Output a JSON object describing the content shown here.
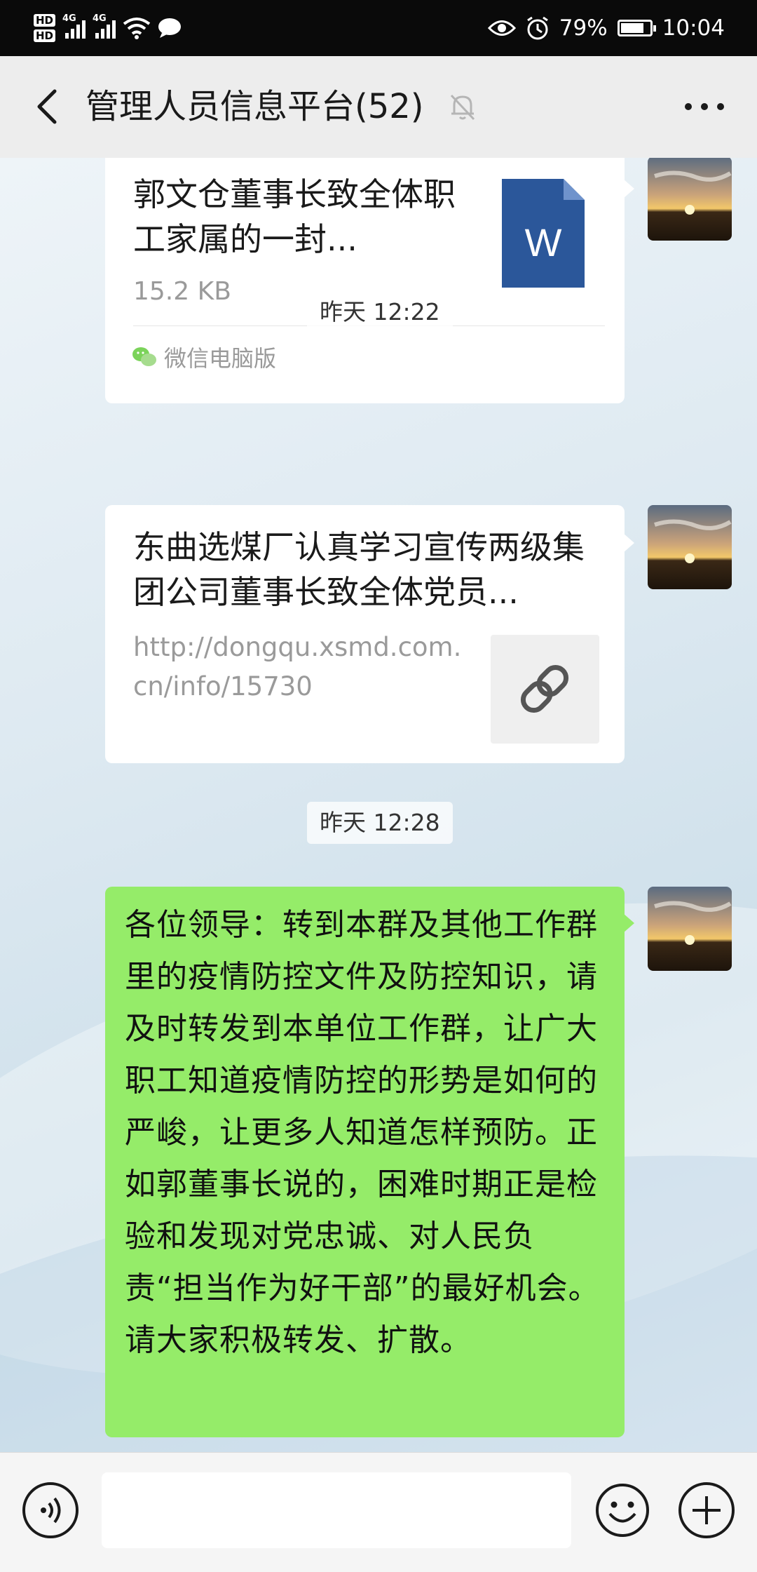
{
  "status_bar": {
    "hd1": "HD",
    "hd2": "HD",
    "net1": "4G",
    "net2": "4G",
    "battery_percent": "79%",
    "battery_level": 0.79,
    "time": "10:04",
    "icons": [
      "signal-icon",
      "wifi-icon",
      "message-icon",
      "eye-icon",
      "alarm-icon",
      "battery-icon"
    ]
  },
  "header": {
    "title": "管理人员信息平台(52)",
    "back_icon": "chevron-left-icon",
    "mute_icon": "bell-off-icon",
    "more_icon": "more-dots-icon"
  },
  "messages": {
    "file_card": {
      "title": "郭文仓董事长致全体职工家属的一封...",
      "size": "15.2 KB",
      "source": "微信电脑版",
      "file_icon_letter": "W"
    },
    "timestamp_1": "昨天 12:22",
    "link_card": {
      "title": "东曲选煤厂认真学习宣传两级集团公司董事长致全体党员...",
      "url": "http://dongqu.xsmd.com.cn/info/15730"
    },
    "timestamp_2": "昨天 12:28",
    "text_bubble": "各位领导：转到本群及其他工作群里的疫情防控文件及防控知识，请及时转发到本单位工作群，让广大职工知道疫情防控的形势是如何的严峻，让更多人知道怎样预防。正如郭董事长说的，困难时期正是检验和发现对党忠诚、对人民负责“担当作为好干部”的最好机会。请大家积极转发、扩散。"
  },
  "input_bar": {
    "placeholder": "",
    "icons": [
      "voice-icon",
      "emoji-icon",
      "plus-icon"
    ]
  },
  "colors": {
    "bubble_green": "#95ec69",
    "header_bg": "#ededed",
    "word_blue": "#2b579a"
  }
}
